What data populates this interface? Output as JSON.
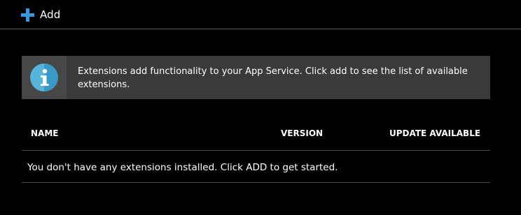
{
  "toolbar": {
    "add_label": "Add",
    "add_icon": "plus-icon"
  },
  "info_banner": {
    "icon": "info-icon",
    "text": "Extensions add functionality to your App Service. Click add to see the list of available extensions."
  },
  "extensions_table": {
    "columns": [
      "NAME",
      "VERSION",
      "UPDATE AVAILABLE"
    ],
    "empty_message": "You don't have any extensions installed. Click ADD to get started."
  },
  "colors": {
    "background": "#000000",
    "accent": "#3a96dd",
    "banner": "#3a3a3a"
  }
}
